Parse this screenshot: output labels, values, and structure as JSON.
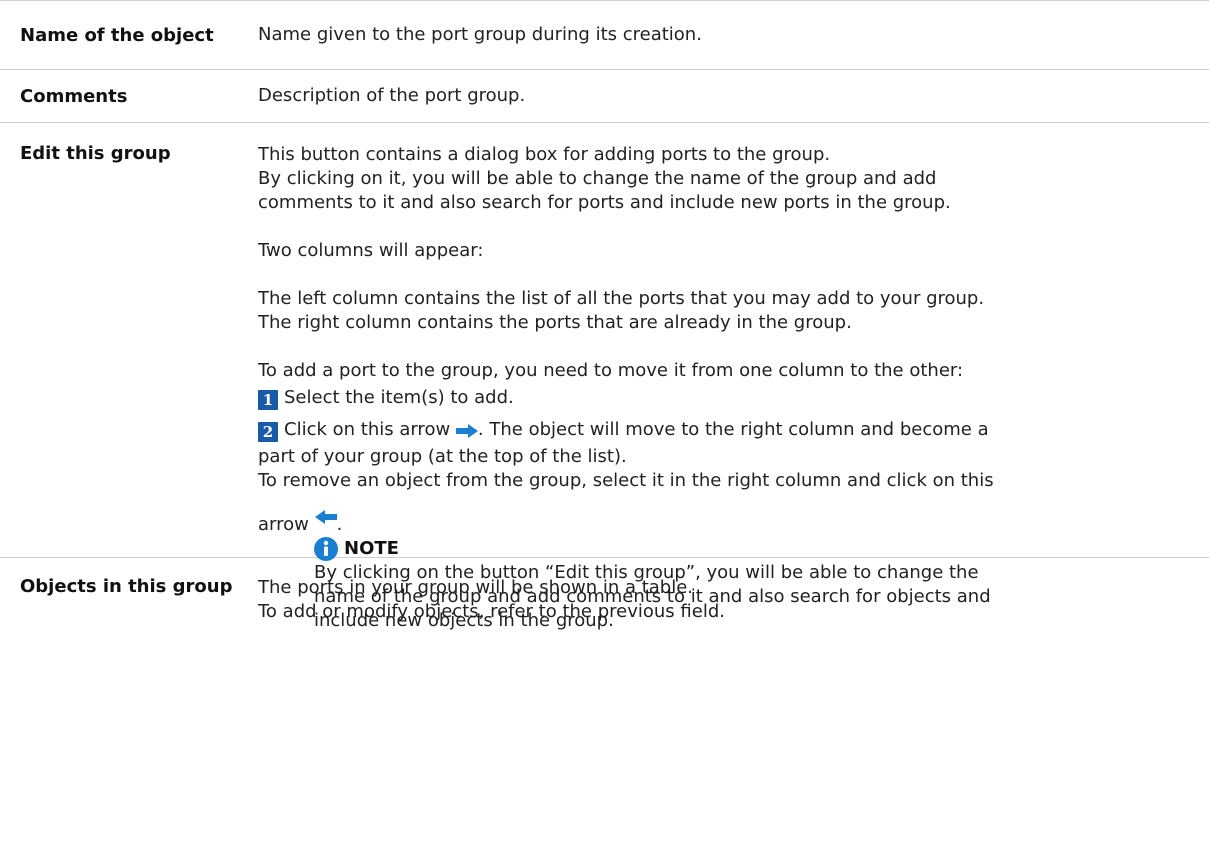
{
  "rows": [
    {
      "label": "Name of the object",
      "desc": "Name given to the port group during its creation."
    },
    {
      "label": "Comments",
      "desc": "Description of the port group."
    },
    {
      "label": "Edit this group",
      "p1a": "This button contains a dialog box for adding ports to the group.",
      "p1b": "By clicking on it, you will be able to change the name of the group and add",
      "p1c": "comments to it and also search for ports and include new ports in the group.",
      "p2": "Two columns will appear:",
      "p3a": "The left column contains the list of all the ports that you may add to your group.",
      "p3b": "The right column contains the ports that are already in the group.",
      "p4": "To add a port to the group, you need to move it from one column to the other:",
      "step1_num": "1",
      "step1": "Select the item(s) to add.",
      "step2_num": "2",
      "step2_pre": "Click on this arrow",
      "step2_post": ". The object will move to the right column and become a",
      "step2_b": "part of your group (at the top of the list).",
      "remove_a": "To remove an object from the group, select it in the right column and click on this",
      "remove_b": "arrow",
      "remove_c": ".",
      "note_title": "NOTE",
      "note_a": "By clicking on the button “Edit this group”, you will be able to change the",
      "note_b": "name of the group and add comments to it and also search for objects and",
      "note_c": "include new objects in the group."
    },
    {
      "label": "Objects in this group",
      "desc_a": "The ports in your group will be shown in a table.",
      "desc_b": "To add or modify objects, refer to the previous field."
    }
  ],
  "icons": {
    "right_arrow": "right-arrow-icon",
    "left_arrow": "left-arrow-icon",
    "info": "info-icon",
    "accent": "#1a7fd0",
    "number_bg": "#1a5aa8"
  }
}
